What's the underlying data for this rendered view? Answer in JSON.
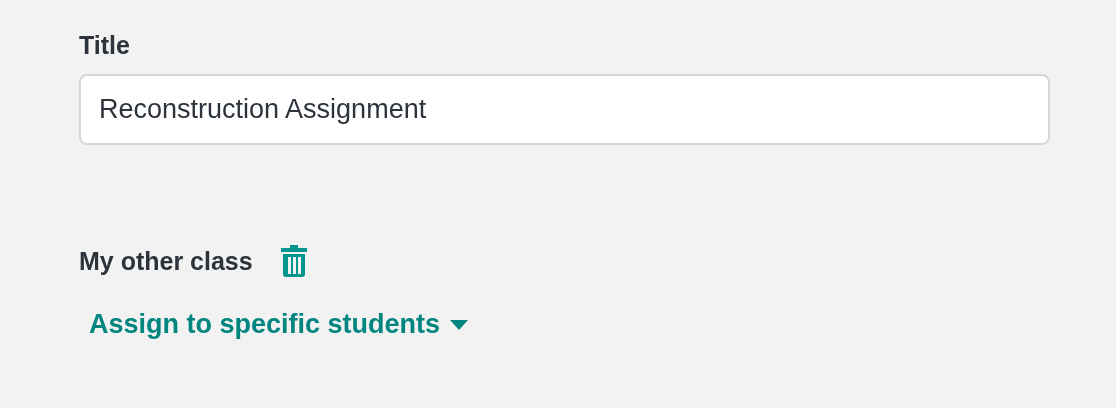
{
  "title_field": {
    "label": "Title",
    "value": "Reconstruction Assignment"
  },
  "class_section": {
    "name": "My other class",
    "assign_link": "Assign to specific students"
  }
}
